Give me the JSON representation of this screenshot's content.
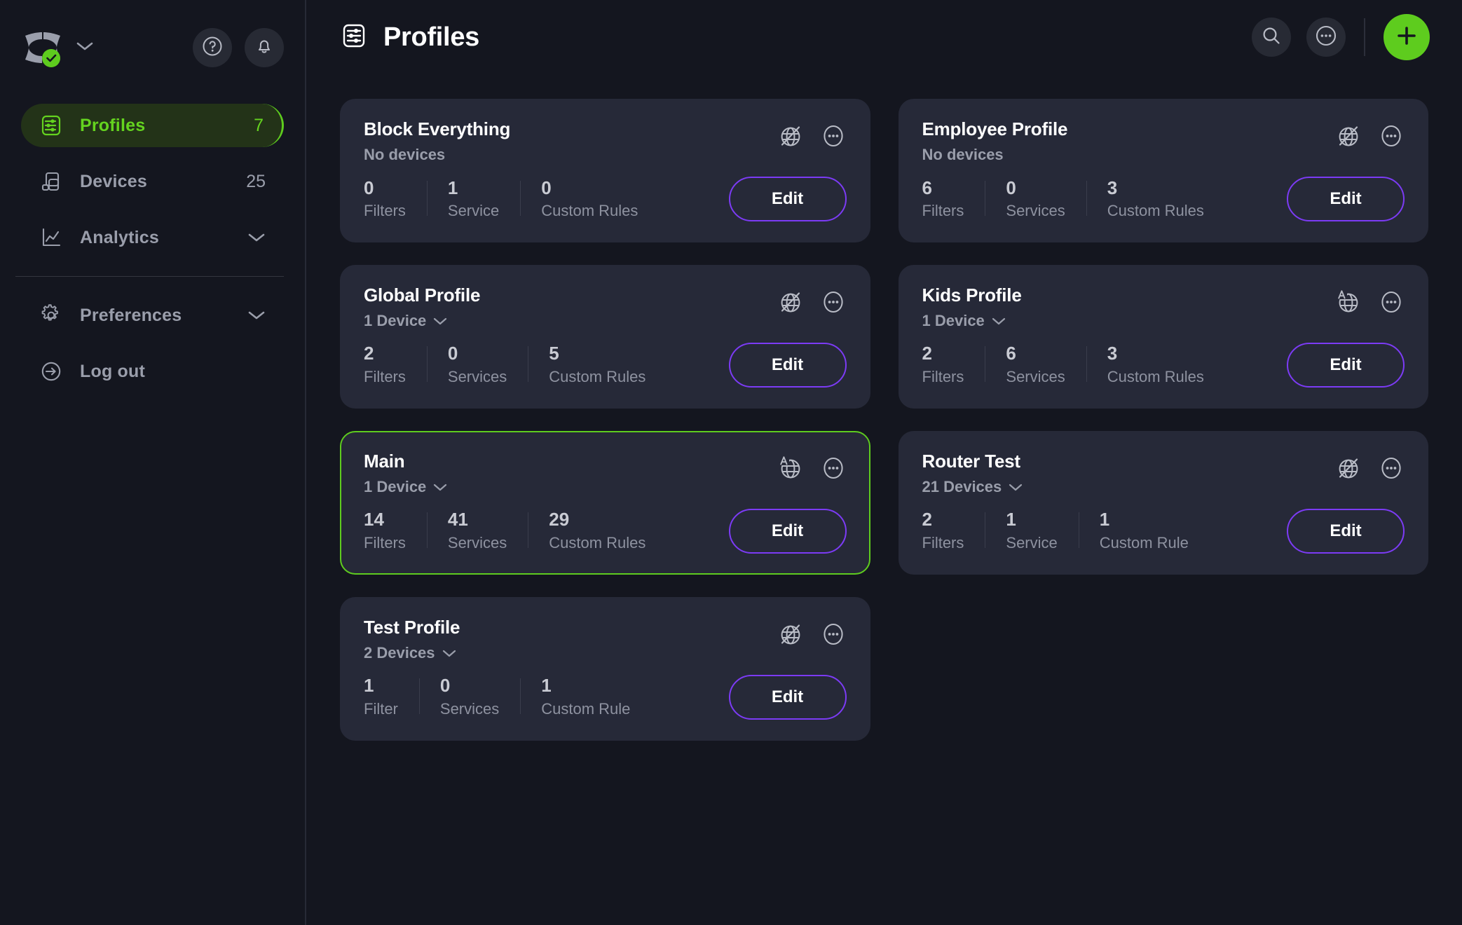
{
  "brand": {
    "logo_name": "control-d-logo",
    "status": "verified",
    "accent_green": "#5ECC1E"
  },
  "sidebar": {
    "help_icon": "help-circle-icon",
    "notifications_icon": "bell-icon",
    "items": [
      {
        "label": "Profiles",
        "icon": "sliders-icon",
        "count": "7",
        "active": true,
        "chevron": false
      },
      {
        "label": "Devices",
        "icon": "devices-icon",
        "count": "25",
        "active": false,
        "chevron": false
      },
      {
        "label": "Analytics",
        "icon": "chart-line-icon",
        "count": "",
        "active": false,
        "chevron": true
      }
    ],
    "lower_items": [
      {
        "label": "Preferences",
        "icon": "gear-icon",
        "count": "",
        "active": false,
        "chevron": true
      },
      {
        "label": "Log out",
        "icon": "logout-icon",
        "count": "",
        "active": false,
        "chevron": false
      }
    ]
  },
  "header": {
    "title": "Profiles",
    "title_icon": "sliders-square-icon",
    "search_icon": "search-icon",
    "more_icon": "more-circle-icon",
    "add_icon": "plus-icon",
    "accent_purple": "#7C3BF5"
  },
  "cards": [
    {
      "name": "Block Everything",
      "devices": "No devices",
      "has_device_chevron": false,
      "globe_icon": "globe-off-icon",
      "more_icon": "more-circle-icon",
      "selected": false,
      "stats": [
        {
          "value": "0",
          "label": "Filters"
        },
        {
          "value": "1",
          "label": "Service"
        },
        {
          "value": "0",
          "label": "Custom Rules"
        }
      ],
      "edit_label": "Edit"
    },
    {
      "name": "Employee Profile",
      "devices": "No devices",
      "has_device_chevron": false,
      "globe_icon": "globe-off-icon",
      "more_icon": "more-circle-icon",
      "selected": false,
      "stats": [
        {
          "value": "6",
          "label": "Filters"
        },
        {
          "value": "0",
          "label": "Services"
        },
        {
          "value": "3",
          "label": "Custom Rules"
        }
      ],
      "edit_label": "Edit"
    },
    {
      "name": "Global Profile",
      "devices": "1 Device",
      "has_device_chevron": true,
      "globe_icon": "globe-off-icon",
      "more_icon": "more-circle-icon",
      "selected": false,
      "stats": [
        {
          "value": "2",
          "label": "Filters"
        },
        {
          "value": "0",
          "label": "Services"
        },
        {
          "value": "5",
          "label": "Custom Rules"
        }
      ],
      "edit_label": "Edit"
    },
    {
      "name": "Kids Profile",
      "devices": "1 Device",
      "has_device_chevron": true,
      "globe_icon": "globe-language-icon",
      "more_icon": "more-circle-icon",
      "selected": false,
      "stats": [
        {
          "value": "2",
          "label": "Filters"
        },
        {
          "value": "6",
          "label": "Services"
        },
        {
          "value": "3",
          "label": "Custom Rules"
        }
      ],
      "edit_label": "Edit"
    },
    {
      "name": "Main",
      "devices": "1 Device",
      "has_device_chevron": true,
      "globe_icon": "globe-language-icon",
      "more_icon": "more-circle-icon",
      "selected": true,
      "stats": [
        {
          "value": "14",
          "label": "Filters"
        },
        {
          "value": "41",
          "label": "Services"
        },
        {
          "value": "29",
          "label": "Custom Rules"
        }
      ],
      "edit_label": "Edit"
    },
    {
      "name": "Router Test",
      "devices": "21 Devices",
      "has_device_chevron": true,
      "globe_icon": "globe-off-icon",
      "more_icon": "more-circle-icon",
      "selected": false,
      "stats": [
        {
          "value": "2",
          "label": "Filters"
        },
        {
          "value": "1",
          "label": "Service"
        },
        {
          "value": "1",
          "label": "Custom Rule"
        }
      ],
      "edit_label": "Edit"
    },
    {
      "name": "Test Profile",
      "devices": "2 Devices",
      "has_device_chevron": true,
      "globe_icon": "globe-off-icon",
      "more_icon": "more-circle-icon",
      "selected": false,
      "stats": [
        {
          "value": "1",
          "label": "Filter"
        },
        {
          "value": "0",
          "label": "Services"
        },
        {
          "value": "1",
          "label": "Custom Rule"
        }
      ],
      "edit_label": "Edit"
    }
  ]
}
